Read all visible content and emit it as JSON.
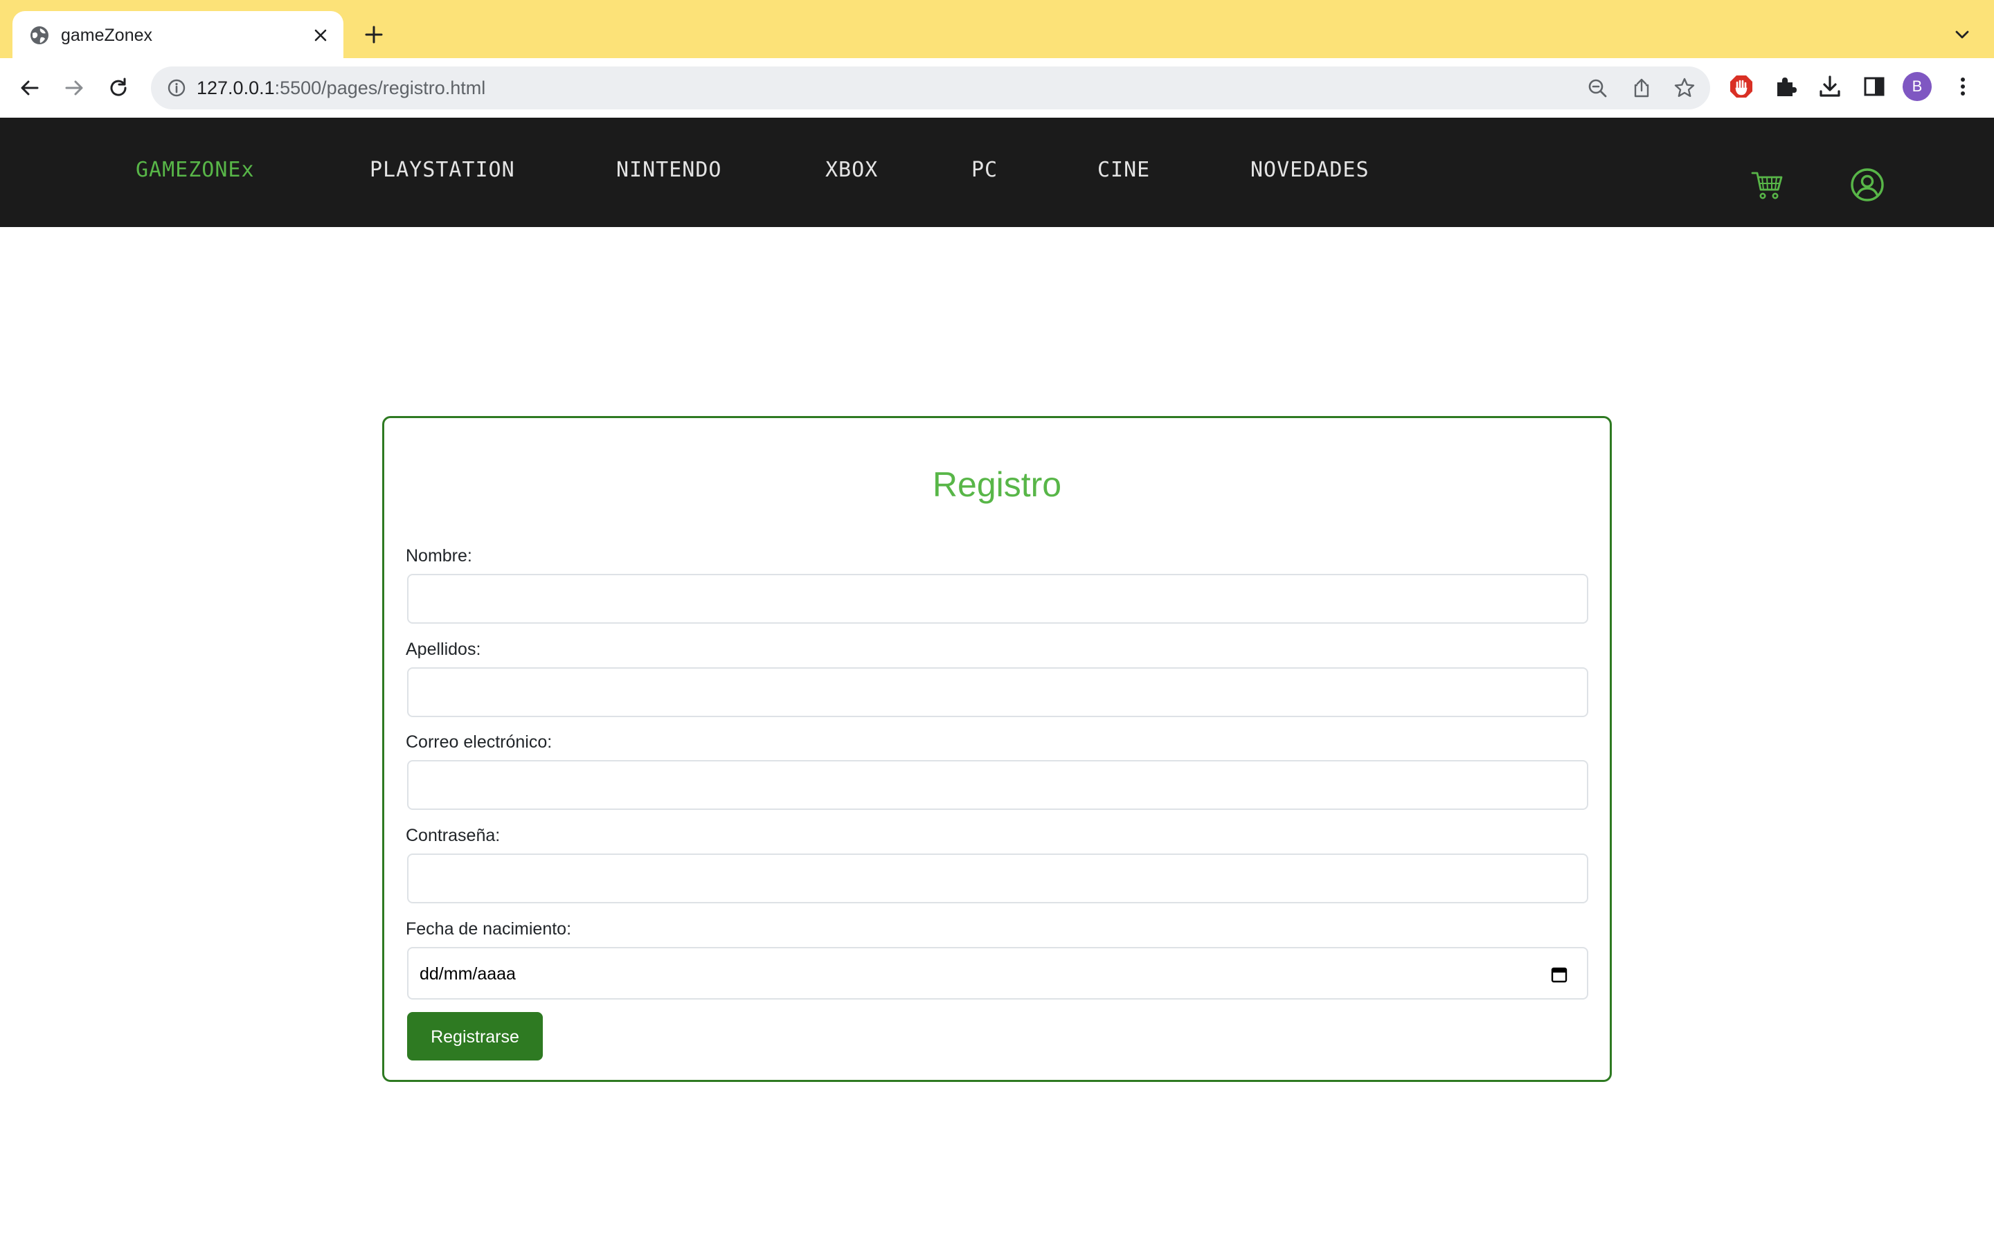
{
  "browser": {
    "tab_title": "gameZonex",
    "url_host": "127.0.0.1",
    "url_rest": ":5500/pages/registro.html",
    "profile_initial": "B"
  },
  "site": {
    "nav": {
      "brand": "GAMEZONEx",
      "items": [
        "PLAYSTATION",
        "NINTENDO",
        "XBOX",
        "PC",
        "CINE",
        "NOVEDADES"
      ]
    },
    "accent_color": "#58b648",
    "nav_background": "#1b1b1b"
  },
  "form": {
    "title": "Registro",
    "fields": [
      {
        "label": "Nombre:",
        "value": ""
      },
      {
        "label": "Apellidos:",
        "value": ""
      },
      {
        "label": "Correo electrónico:",
        "value": ""
      },
      {
        "label": "Contraseña:",
        "value": ""
      },
      {
        "label": "Fecha de nacimiento:",
        "placeholder": "dd/mm/aaaa"
      }
    ],
    "submit_label": "Registrarse",
    "button_color": "#2e7a22"
  },
  "icons": {
    "tab": [
      "globe-icon",
      "close-icon",
      "plus-icon",
      "chevron-down-icon"
    ],
    "toolbar": [
      "back-arrow-icon",
      "forward-arrow-icon",
      "reload-icon",
      "info-icon",
      "zoom-out-icon",
      "share-icon",
      "star-icon",
      "adblock-icon",
      "puzzle-icon",
      "download-icon",
      "sidepanel-icon",
      "more-vert-icon"
    ],
    "site": [
      "cart-icon",
      "user-circle-icon",
      "calendar-icon"
    ]
  }
}
